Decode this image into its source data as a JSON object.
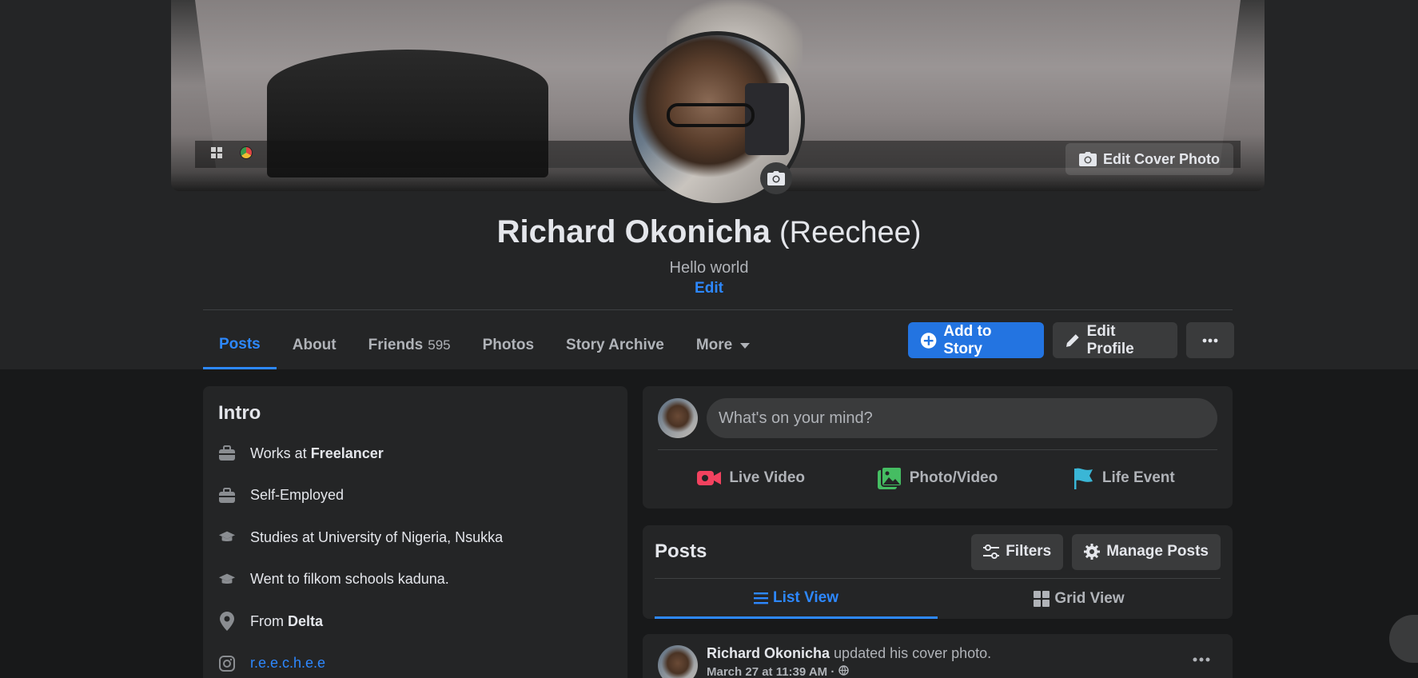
{
  "profile": {
    "name": "Richard Okonicha",
    "alt_name": "(Reechee)",
    "bio": "Hello world",
    "bio_edit_label": "Edit",
    "edit_cover_label": "Edit Cover Photo"
  },
  "tabs": [
    {
      "label": "Posts",
      "active": true
    },
    {
      "label": "About"
    },
    {
      "label": "Friends",
      "count": "595"
    },
    {
      "label": "Photos"
    },
    {
      "label": "Story Archive"
    },
    {
      "label": "More"
    }
  ],
  "actions": {
    "add_story": "Add to Story",
    "edit_profile": "Edit Profile"
  },
  "intro": {
    "title": "Intro",
    "items": [
      {
        "icon": "briefcase-icon",
        "prefix": "Works at ",
        "bold": "Freelancer"
      },
      {
        "icon": "briefcase-icon",
        "text": "Self-Employed"
      },
      {
        "icon": "graduation-cap-icon",
        "text": "Studies at University of Nigeria, Nsukka"
      },
      {
        "icon": "graduation-cap-icon",
        "text": "Went to filkom schools kaduna."
      },
      {
        "icon": "location-pin-icon",
        "prefix": "From ",
        "bold": "Delta"
      },
      {
        "icon": "instagram-icon",
        "link": "r.e.e.c.h.e.e"
      }
    ]
  },
  "composer": {
    "placeholder": "What's on your mind?",
    "live_video": "Live Video",
    "photo_video": "Photo/Video",
    "life_event": "Life Event"
  },
  "posts": {
    "title": "Posts",
    "filters": "Filters",
    "manage": "Manage Posts",
    "list_view": "List View",
    "grid_view": "Grid View"
  },
  "post": {
    "author": "Richard Okonicha",
    "action": " updated his cover photo.",
    "time": "March 27 at 11:39 AM · "
  },
  "colors": {
    "accent": "#2d88ff",
    "background": "#18191a",
    "card": "#242526"
  }
}
